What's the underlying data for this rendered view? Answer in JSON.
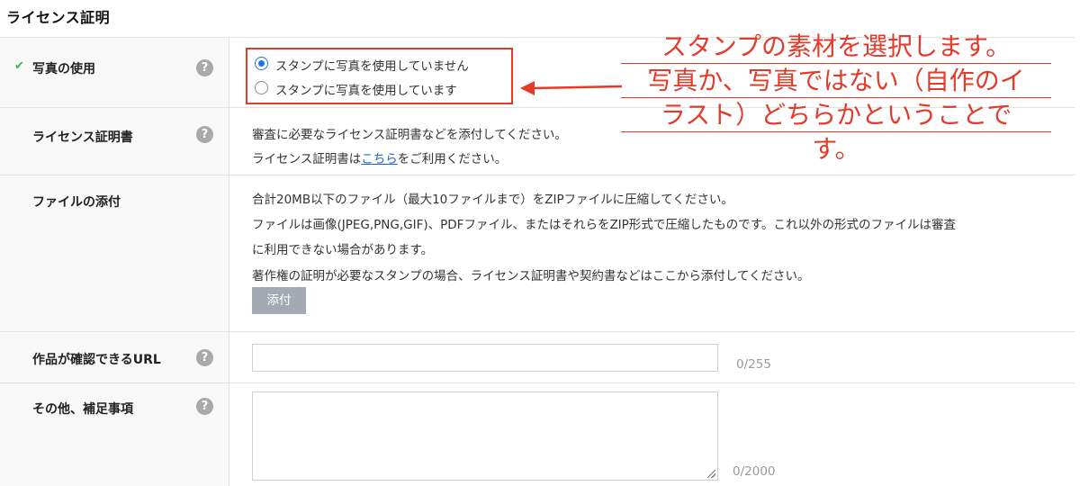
{
  "section": {
    "title": "ライセンス証明"
  },
  "rows": {
    "photo": {
      "label": "写真の使用",
      "options": [
        {
          "label": "スタンプに写真を使用していません",
          "selected": true
        },
        {
          "label": "スタンプに写真を使用しています",
          "selected": false
        }
      ]
    },
    "license": {
      "label": "ライセンス証明書",
      "line1": "審査に必要なライセンス証明書などを添付してください。",
      "line2_prefix": "ライセンス証明書は",
      "line2_link": "こちら",
      "line2_suffix": "をご利用ください。"
    },
    "attachment": {
      "label": "ファイルの添付",
      "line1": "合計20MB以下のファイル（最大10ファイルまで）をZIPファイルに圧縮してください。",
      "line2": "ファイルは画像(JPEG,PNG,GIF)、PDFファイル、またはそれらをZIP形式で圧縮したものです。これ以外の形式のファイルは審査",
      "line3": "に利用できない場合があります。",
      "line4": "著作権の証明が必要なスタンプの場合、ライセンス証明書や契約書などはここから添付してください。",
      "button": "添付"
    },
    "url": {
      "label": "作品が確認できるURL",
      "value": "",
      "counter": "0/255"
    },
    "notes": {
      "label": "その他、補足事項",
      "value": "",
      "counter": "0/2000"
    }
  },
  "annotation": {
    "lines": [
      "スタンプの素材を選択します。",
      "写真か、写真ではない（自作のイ",
      "ラスト）どちらかということで",
      "す。"
    ],
    "color": "#e33b2a"
  },
  "icons": {
    "check": "check-icon",
    "help": "help-icon",
    "arrow": "arrow-left-icon"
  }
}
